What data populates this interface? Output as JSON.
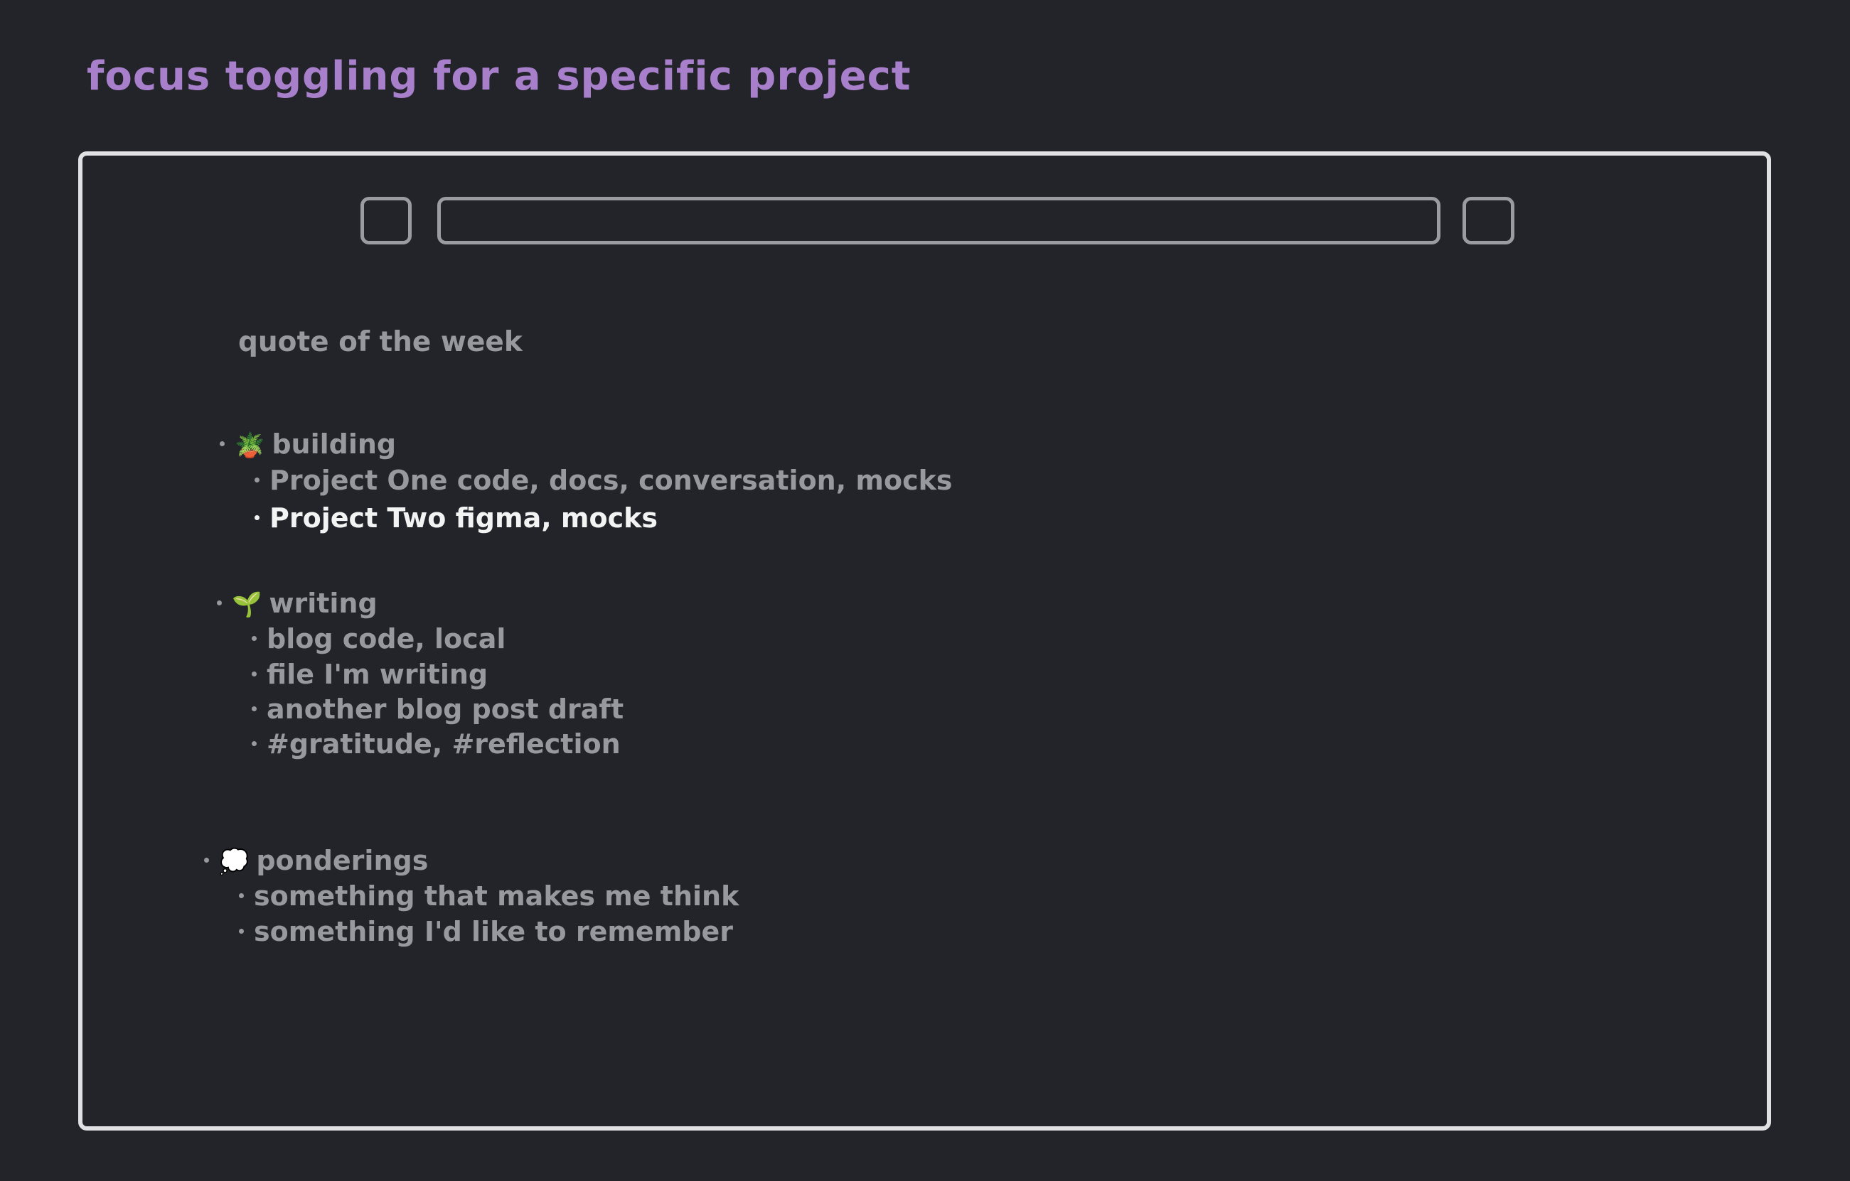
{
  "title": "focus toggling for a specific project",
  "toolbar": {
    "left_button": "",
    "address": "",
    "right_button": ""
  },
  "quote_label": "quote of the week",
  "sections": [
    {
      "icon": "potted-plant-icon",
      "emoji": "🪴",
      "label": "building",
      "items": [
        {
          "text": "Project One code, docs, conversation, mocks",
          "focused": false
        },
        {
          "text": "Project Two figma, mocks",
          "focused": true
        }
      ]
    },
    {
      "icon": "seedling-icon",
      "emoji": "🌱",
      "label": "writing",
      "items": [
        {
          "text": "blog code, local",
          "focused": false
        },
        {
          "text": "file I'm writing",
          "focused": false
        },
        {
          "text": "another blog post draft",
          "focused": false
        },
        {
          "text": "#gratitude, #reflection",
          "focused": false
        }
      ]
    },
    {
      "icon": "thought-balloon-icon",
      "emoji": "💭",
      "label": "ponderings",
      "items": [
        {
          "text": "something that makes me think",
          "focused": false
        },
        {
          "text": "something I'd like to remember",
          "focused": false
        }
      ]
    }
  ],
  "colors": {
    "background": "#222429",
    "title": "#a87fcb",
    "frame": "#e1e1e3",
    "text_dim": "#98999e",
    "text_focused": "#f3f3f4"
  }
}
